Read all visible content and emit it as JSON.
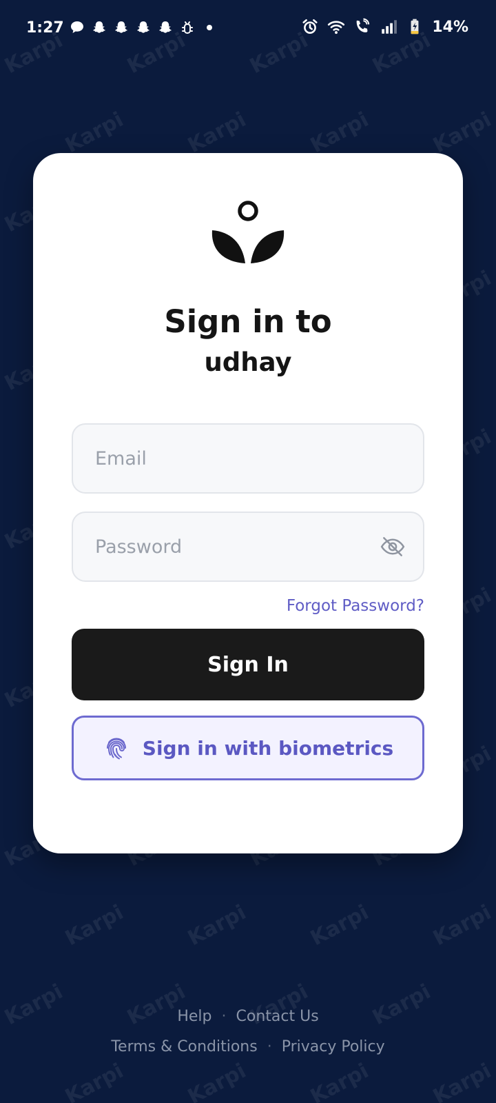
{
  "status_bar": {
    "time": "1:27",
    "battery": "14%",
    "notification_icons": [
      "message-bubble-icon",
      "snapchat-ghost-icon",
      "snapchat-ghost-icon",
      "snapchat-ghost-icon",
      "snapchat-ghost-icon",
      "bug-icon",
      "dot-icon"
    ],
    "system_icons": [
      "alarm-icon",
      "wifi-icon",
      "wifi-call-icon",
      "signal-icon",
      "battery-charging-icon"
    ]
  },
  "watermark": {
    "text": "Karpi"
  },
  "card": {
    "logo_icon": "sprout-logo-icon",
    "title_line1": "Sign in to",
    "title_line2": "udhay",
    "email": {
      "placeholder": "Email",
      "value": ""
    },
    "password": {
      "placeholder": "Password",
      "value": "",
      "toggle_icon": "eye-off-icon"
    },
    "forgot_password": "Forgot Password?",
    "sign_in_button": "Sign In",
    "biometric_button": {
      "label": "Sign in with biometrics",
      "icon": "fingerprint-icon"
    }
  },
  "footer": {
    "row1": [
      "Help",
      "Contact Us"
    ],
    "row2": [
      "Terms & Conditions",
      "Privacy Policy"
    ],
    "separator": "·"
  },
  "colors": {
    "background": "#0b1b3d",
    "card": "#ffffff",
    "primary_button": "#1a1a1a",
    "accent": "#5f5cc5",
    "biometric_bg": "#f3f2ff"
  }
}
